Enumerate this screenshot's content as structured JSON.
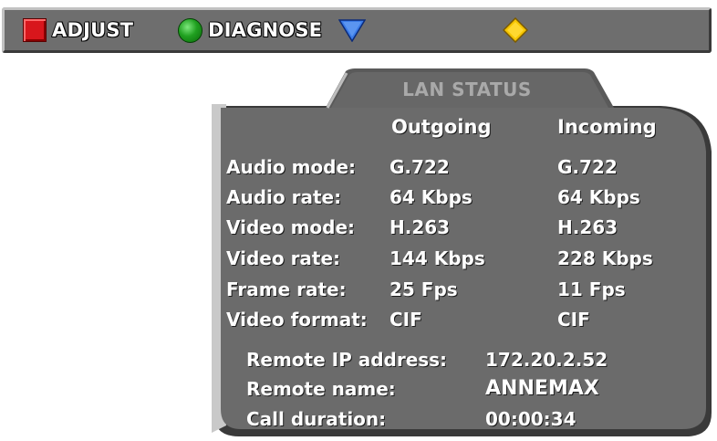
{
  "toolbar": {
    "adjust": {
      "label": "ADJUST",
      "icon": "red-square-icon",
      "color": "#d8161c"
    },
    "diagnose": {
      "label": "DIAGNOSE",
      "icon": "green-circle-icon",
      "color": "#20a020"
    },
    "down_arrow": {
      "icon": "blue-down-triangle-icon",
      "color": "#3a7be8"
    },
    "diamond": {
      "icon": "yellow-diamond-icon",
      "color": "#f5c400"
    }
  },
  "panel": {
    "title": "LAN STATUS",
    "columns": {
      "outgoing": "Outgoing",
      "incoming": "Incoming"
    },
    "rows": [
      {
        "label": "Audio mode:",
        "outgoing": "G.722",
        "incoming": "G.722"
      },
      {
        "label": "Audio rate:",
        "outgoing": "64 Kbps",
        "incoming": "64 Kbps"
      },
      {
        "label": "Video mode:",
        "outgoing": "H.263",
        "incoming": "H.263"
      },
      {
        "label": "Video rate:",
        "outgoing": "144 Kbps",
        "incoming": "228 Kbps"
      },
      {
        "label": "Frame rate:",
        "outgoing": "25 Fps",
        "incoming": "11 Fps"
      },
      {
        "label": "Video format:",
        "outgoing": "CIF",
        "incoming": "CIF"
      }
    ],
    "remote": {
      "ip_label": "Remote IP address:",
      "ip_value": "172.20.2.52",
      "name_label": "Remote name:",
      "name_value": "ANNEMAX",
      "duration_label": "Call duration:",
      "duration_value": "00:00:34"
    },
    "colors": {
      "panel": "#6b6b6b",
      "tab": "#646464",
      "text": "#ffffff",
      "title": "#a9a9a9"
    }
  }
}
